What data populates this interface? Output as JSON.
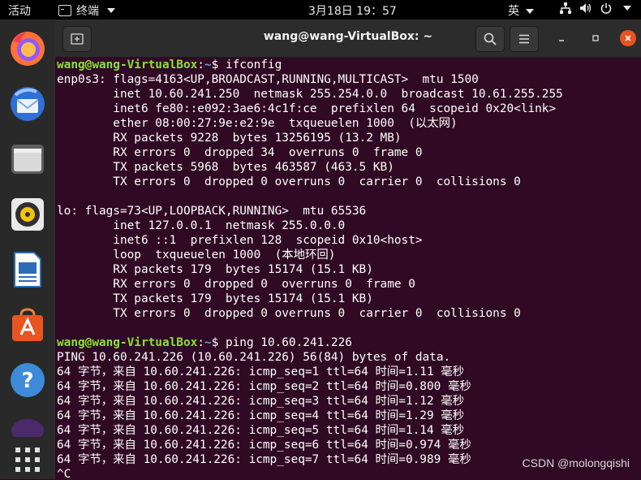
{
  "topbar": {
    "activities": "活动",
    "app_name": "终端",
    "clock": "3月18日 19：57",
    "ime": "英"
  },
  "dock": {
    "items": [
      {
        "name": "firefox-icon",
        "active": false
      },
      {
        "name": "thunderbird-icon",
        "active": false
      },
      {
        "name": "files-icon",
        "active": false
      },
      {
        "name": "rhythmbox-icon",
        "active": false
      },
      {
        "name": "libreoffice-writer-icon",
        "active": false
      },
      {
        "name": "ubuntu-software-icon",
        "active": false
      },
      {
        "name": "help-icon",
        "active": false
      },
      {
        "name": "terminal-icon",
        "active": true
      }
    ]
  },
  "window": {
    "title": "wang@wang-VirtualBox: ~"
  },
  "terminal": {
    "prompt_user": "wang@wang-VirtualBox",
    "prompt_sep": ":",
    "prompt_path": "~",
    "prompt_end": "$ ",
    "cmd1": "ifconfig",
    "ifconfig_lines": [
      "enp0s3: flags=4163<UP,BROADCAST,RUNNING,MULTICAST>  mtu 1500",
      "        inet 10.60.241.250  netmask 255.254.0.0  broadcast 10.61.255.255",
      "        inet6 fe80::e092:3ae6:4c1f:ce  prefixlen 64  scopeid 0x20<link>",
      "        ether 08:00:27:9e:e2:9e  txqueuelen 1000  (以太网)",
      "        RX packets 9228  bytes 13256195 (13.2 MB)",
      "        RX errors 0  dropped 34  overruns 0  frame 0",
      "        TX packets 5968  bytes 463587 (463.5 KB)",
      "        TX errors 0  dropped 0 overruns 0  carrier 0  collisions 0",
      "",
      "lo: flags=73<UP,LOOPBACK,RUNNING>  mtu 65536",
      "        inet 127.0.0.1  netmask 255.0.0.0",
      "        inet6 ::1  prefixlen 128  scopeid 0x10<host>",
      "        loop  txqueuelen 1000  (本地环回)",
      "        RX packets 179  bytes 15174 (15.1 KB)",
      "        RX errors 0  dropped 0  overruns 0  frame 0",
      "        TX packets 179  bytes 15174 (15.1 KB)",
      "        TX errors 0  dropped 0 overruns 0  carrier 0  collisions 0",
      ""
    ],
    "cmd2": "ping 10.60.241.226",
    "ping_lines": [
      "PING 10.60.241.226 (10.60.241.226) 56(84) bytes of data.",
      "64 字节，来自 10.60.241.226: icmp_seq=1 ttl=64 时间=1.11 毫秒",
      "64 字节，来自 10.60.241.226: icmp_seq=2 ttl=64 时间=0.800 毫秒",
      "64 字节，来自 10.60.241.226: icmp_seq=3 ttl=64 时间=1.12 毫秒",
      "64 字节，来自 10.60.241.226: icmp_seq=4 ttl=64 时间=1.29 毫秒",
      "64 字节，来自 10.60.241.226: icmp_seq=5 ttl=64 时间=1.14 毫秒",
      "64 字节，来自 10.60.241.226: icmp_seq=6 ttl=64 时间=0.974 毫秒",
      "64 字节，来自 10.60.241.226: icmp_seq=7 ttl=64 时间=0.989 毫秒",
      "^C"
    ]
  },
  "watermark": "CSDN @molongqishi"
}
